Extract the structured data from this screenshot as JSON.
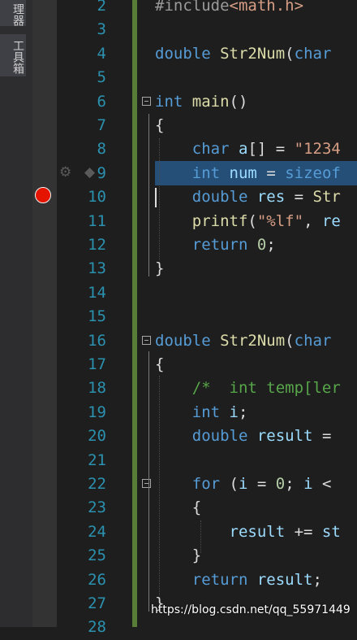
{
  "side_panel": {
    "tab_top_label": "理器",
    "toolbox_label": "工具箱"
  },
  "editor": {
    "lines": [
      {
        "n": "2",
        "tokens": [
          {
            "t": "#include",
            "c": "pp"
          },
          {
            "t": "<math.h>",
            "c": "inc"
          }
        ]
      },
      {
        "n": "3",
        "tokens": []
      },
      {
        "n": "4",
        "tokens": [
          {
            "t": "double",
            "c": "kw"
          },
          {
            "t": " ",
            "c": ""
          },
          {
            "t": "Str2Num",
            "c": "fn"
          },
          {
            "t": "(",
            "c": ""
          },
          {
            "t": "char",
            "c": "kw"
          }
        ]
      },
      {
        "n": "5",
        "tokens": []
      },
      {
        "n": "6",
        "tokens": [
          {
            "t": "int",
            "c": "kw"
          },
          {
            "t": " ",
            "c": ""
          },
          {
            "t": "main",
            "c": "fn"
          },
          {
            "t": "()",
            "c": ""
          }
        ]
      },
      {
        "n": "7",
        "tokens": [
          {
            "t": "{",
            "c": ""
          }
        ]
      },
      {
        "n": "8",
        "tokens": [
          {
            "t": "    ",
            "c": ""
          },
          {
            "t": "char",
            "c": "kw"
          },
          {
            "t": " ",
            "c": ""
          },
          {
            "t": "a",
            "c": "var"
          },
          {
            "t": "[] = ",
            "c": ""
          },
          {
            "t": "\"1234",
            "c": "str"
          }
        ]
      },
      {
        "n": "9",
        "tokens": [
          {
            "t": "    ",
            "c": ""
          },
          {
            "t": "int",
            "c": "kw"
          },
          {
            "t": " ",
            "c": ""
          },
          {
            "t": "num",
            "c": "var"
          },
          {
            "t": " = ",
            "c": ""
          },
          {
            "t": "sizeof",
            "c": "kw"
          }
        ]
      },
      {
        "n": "10",
        "tokens": [
          {
            "t": "    ",
            "c": ""
          },
          {
            "t": "double",
            "c": "kw"
          },
          {
            "t": " ",
            "c": ""
          },
          {
            "t": "res",
            "c": "var"
          },
          {
            "t": " = ",
            "c": ""
          },
          {
            "t": "Str",
            "c": "fn"
          }
        ]
      },
      {
        "n": "11",
        "tokens": [
          {
            "t": "    ",
            "c": ""
          },
          {
            "t": "printf",
            "c": "fn"
          },
          {
            "t": "(",
            "c": ""
          },
          {
            "t": "\"%lf\"",
            "c": "str"
          },
          {
            "t": ", ",
            "c": ""
          },
          {
            "t": "re",
            "c": "var"
          }
        ]
      },
      {
        "n": "12",
        "tokens": [
          {
            "t": "    ",
            "c": ""
          },
          {
            "t": "return",
            "c": "kw"
          },
          {
            "t": " ",
            "c": ""
          },
          {
            "t": "0",
            "c": "num"
          },
          {
            "t": ";",
            "c": ""
          }
        ]
      },
      {
        "n": "13",
        "tokens": [
          {
            "t": "}",
            "c": ""
          }
        ]
      },
      {
        "n": "14",
        "tokens": []
      },
      {
        "n": "15",
        "tokens": []
      },
      {
        "n": "16",
        "tokens": [
          {
            "t": "double",
            "c": "kw"
          },
          {
            "t": " ",
            "c": ""
          },
          {
            "t": "Str2Num",
            "c": "fn"
          },
          {
            "t": "(",
            "c": ""
          },
          {
            "t": "char",
            "c": "kw"
          }
        ]
      },
      {
        "n": "17",
        "tokens": [
          {
            "t": "{",
            "c": ""
          }
        ]
      },
      {
        "n": "18",
        "tokens": [
          {
            "t": "    ",
            "c": ""
          },
          {
            "t": "/*  int temp[ler",
            "c": "cmt"
          }
        ]
      },
      {
        "n": "19",
        "tokens": [
          {
            "t": "    ",
            "c": ""
          },
          {
            "t": "int",
            "c": "kw"
          },
          {
            "t": " ",
            "c": ""
          },
          {
            "t": "i",
            "c": "var"
          },
          {
            "t": ";",
            "c": ""
          }
        ]
      },
      {
        "n": "20",
        "tokens": [
          {
            "t": "    ",
            "c": ""
          },
          {
            "t": "double",
            "c": "kw"
          },
          {
            "t": " ",
            "c": ""
          },
          {
            "t": "result",
            "c": "var"
          },
          {
            "t": " = ",
            "c": ""
          }
        ]
      },
      {
        "n": "21",
        "tokens": []
      },
      {
        "n": "22",
        "tokens": [
          {
            "t": "    ",
            "c": ""
          },
          {
            "t": "for",
            "c": "kw"
          },
          {
            "t": " (",
            "c": ""
          },
          {
            "t": "i",
            "c": "var"
          },
          {
            "t": " = ",
            "c": ""
          },
          {
            "t": "0",
            "c": "num"
          },
          {
            "t": "; ",
            "c": ""
          },
          {
            "t": "i",
            "c": "var"
          },
          {
            "t": " <",
            "c": ""
          }
        ]
      },
      {
        "n": "23",
        "tokens": [
          {
            "t": "    {",
            "c": ""
          }
        ]
      },
      {
        "n": "24",
        "tokens": [
          {
            "t": "        ",
            "c": ""
          },
          {
            "t": "result",
            "c": "var"
          },
          {
            "t": " += ",
            "c": ""
          },
          {
            "t": "st",
            "c": "var"
          }
        ]
      },
      {
        "n": "25",
        "tokens": [
          {
            "t": "    }",
            "c": ""
          }
        ]
      },
      {
        "n": "26",
        "tokens": [
          {
            "t": "    ",
            "c": ""
          },
          {
            "t": "return",
            "c": "kw"
          },
          {
            "t": " ",
            "c": ""
          },
          {
            "t": "result",
            "c": "var"
          },
          {
            "t": ";",
            "c": ""
          }
        ]
      },
      {
        "n": "27",
        "tokens": [
          {
            "t": "}",
            "c": ""
          }
        ]
      },
      {
        "n": "28",
        "tokens": []
      }
    ],
    "fold_lines": [
      "6",
      "16",
      "22"
    ],
    "breakpoint_line": "10",
    "current_line": "9"
  },
  "watermark": "https://blog.csdn.net/qq_55971449",
  "colors": {
    "keyword": "#569cd6",
    "string": "#d69d85",
    "number": "#b5cea8",
    "function": "#dcdcaa",
    "variable": "#9cdcfe",
    "comment": "#57a64a",
    "line_number": "#2b91af",
    "breakpoint": "#e51400",
    "change_bar": "#577d36",
    "selection": "#264f78"
  }
}
